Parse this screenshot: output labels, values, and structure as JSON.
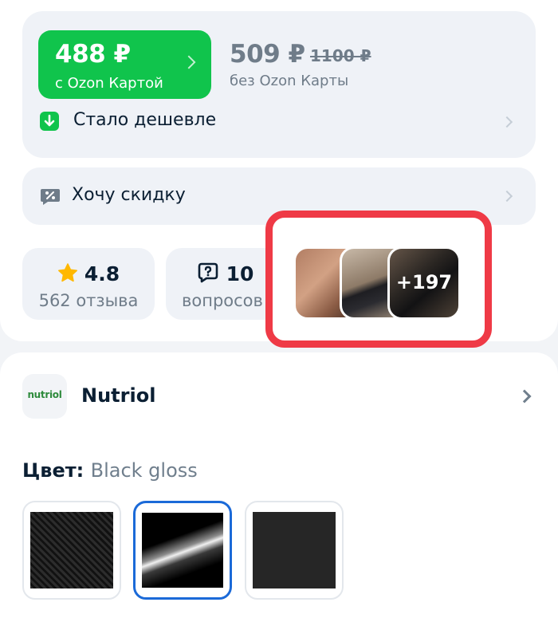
{
  "price": {
    "ozon_card_price": "488 ₽",
    "ozon_card_caption": "с Ozon Картой",
    "regular_price": "509 ₽",
    "old_price": "1100 ₽",
    "regular_caption": "без Ozon Карты",
    "cheaper_label": "Стало дешевле"
  },
  "discount": {
    "label": "Хочу скидку"
  },
  "rating": {
    "value": "4.8",
    "reviews": "562 отзыва"
  },
  "questions": {
    "count": "10",
    "label": "вопросов"
  },
  "photos": {
    "more_count": "+197"
  },
  "brand": {
    "logo_text": "nutriol",
    "name": "Nutriol"
  },
  "color": {
    "label": "Цвет:",
    "selected_value": "Black gloss",
    "selected_index": 1
  },
  "colors": {
    "accent_green": "#10c44c",
    "highlight_red": "#ef3a46",
    "selected_blue": "#1b6ad8"
  },
  "icons": [
    "arrow-down-icon",
    "discount-tag-icon",
    "star-icon",
    "question-bubble-icon",
    "chevron-right-icon"
  ]
}
